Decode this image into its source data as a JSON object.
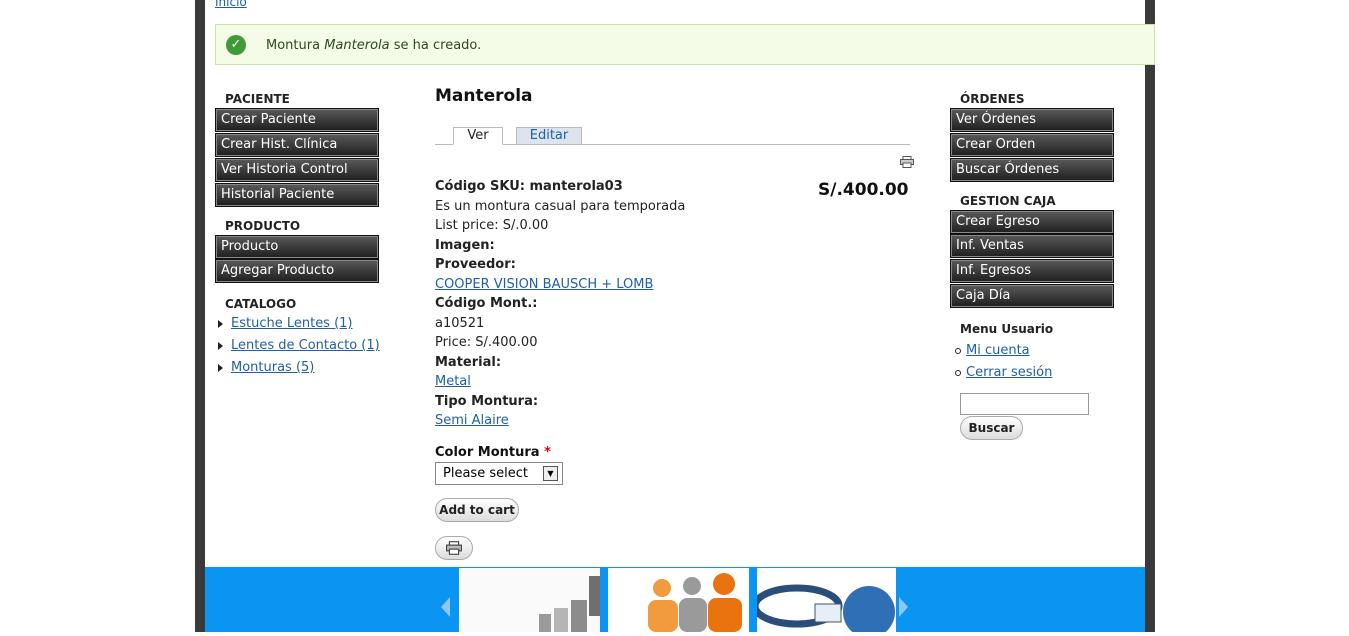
{
  "breadcrumb": {
    "home": "Inicio"
  },
  "message": {
    "prefix": "Montura ",
    "name": "Manterola",
    "suffix": " se ha creado."
  },
  "left": {
    "paciente_title": "PACIENTE",
    "paciente_items": [
      "Crear Paciente",
      "Crear Hist. Clínica",
      "Ver Historia Control",
      "Historial Paciente"
    ],
    "producto_title": "PRODUCTO",
    "producto_items": [
      "Producto",
      "Agregar Producto"
    ],
    "catalogo_title": "CATALOGO",
    "catalogo_items": [
      "Estuche Lentes (1)",
      "Lentes de Contacto (1)",
      "Monturas (5)"
    ]
  },
  "main": {
    "title": "Manterola",
    "tabs": [
      "Ver",
      "Editar"
    ],
    "price": "S/.400.00",
    "sku_label": "Código SKU:",
    "sku_value": " manterola03",
    "description": "Es un montura casual para temporada",
    "list_price": "List price: S/.0.00",
    "imagen_label": "Imagen:",
    "proveedor_label": "Proveedor:",
    "proveedor_value": "COOPER VISION BAUSCH + LOMB",
    "codigo_label": "Código Mont.:",
    "codigo_value": "a10521",
    "price_line": "Price: S/.400.00",
    "material_label": "Material:",
    "material_value": "Metal",
    "tipo_label": "Tipo Montura:",
    "tipo_value": "Semi Alaire",
    "color_label": "Color Montura",
    "required_mark": "*",
    "color_select": "Please select",
    "add_to_cart": "Add to cart"
  },
  "right": {
    "ordenes_title": "ÓRDENES",
    "ordenes_items": [
      "Ver Órdenes",
      "Crear Orden",
      "Buscar Órdenes"
    ],
    "caja_title": "GESTION CAJA",
    "caja_items": [
      "Crear Egreso",
      "Inf. Ventas",
      "Inf. Egresos",
      "Caja Día"
    ],
    "usuario_title": "Menu Usuario",
    "usuario_items": [
      "Mi cuenta",
      "Cerrar sesión"
    ],
    "search_button": "Buscar"
  },
  "colors": {
    "frame": "#3a3a3a",
    "footer": "#0a95f2",
    "link": "#1f5fa8",
    "success_bg": "#f4fbe6"
  }
}
